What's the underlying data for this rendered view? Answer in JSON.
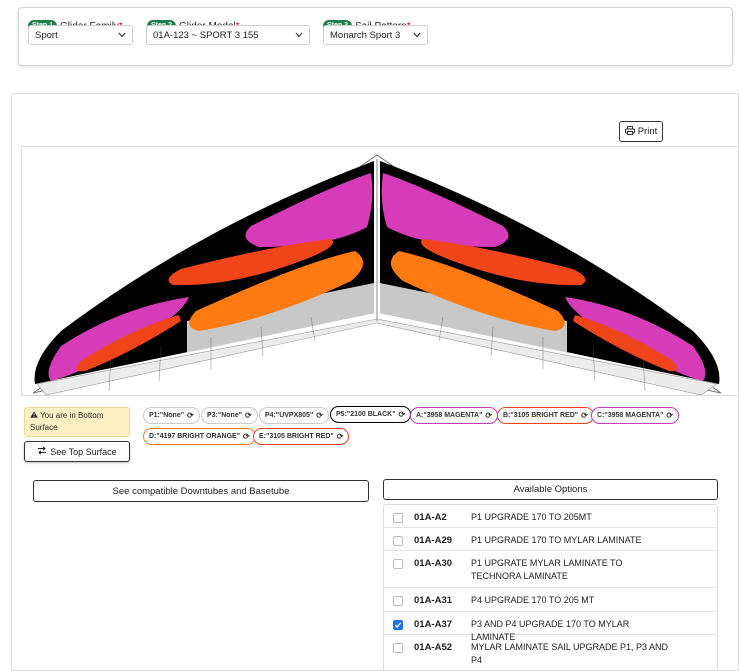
{
  "steps": [
    {
      "badge": "Step 1",
      "label": "Glider Family",
      "required": "*",
      "value": "Sport"
    },
    {
      "badge": "Step 2",
      "label": "Glider Model",
      "required": "*",
      "value": "01A-123 ~ SPORT 3 155"
    },
    {
      "badge": "Step 3",
      "label": "Sail Pattern",
      "required": "*",
      "value": "Monarch Sport 3"
    }
  ],
  "print_label": "Print",
  "surface_note": "You are in Bottom Surface",
  "see_top_label": "See Top Surface",
  "pills": [
    {
      "text": "P1:\"None\"",
      "color": "#cfcfcf"
    },
    {
      "text": "P3:\"None\"",
      "color": "#cfcfcf"
    },
    {
      "text": "P4:\"UVPX805\"",
      "color": "#cfcfcf"
    },
    {
      "text": "P5:\"2100 BLACK\"",
      "color": "#000000"
    },
    {
      "text": "A:\"3958 MAGENTA\"",
      "color": "#c53bbb"
    },
    {
      "text": "B:\"3105 BRIGHT RED\"",
      "color": "#e8451e"
    },
    {
      "text": "C:\"3958 MAGENTA\"",
      "color": "#c53bbb"
    },
    {
      "text": "D:\"4197 BRIGHT ORANGE\"",
      "color": "#f07a22"
    },
    {
      "text": "E:\"3105 BRIGHT RED\"",
      "color": "#e8451e"
    }
  ],
  "compat_label": "See compatible Downtubes and Basetube",
  "available_label": "Available Options",
  "options": [
    {
      "code": "01A-A2",
      "desc": "P1 UPGRADE 170 TO 205MT",
      "checked": false
    },
    {
      "code": "01A-A29",
      "desc": "P1 UPGRADE 170 TO MYLAR LAMINATE",
      "checked": false
    },
    {
      "code": "01A-A30",
      "desc": "P1 UPGRATE MYLAR LAMINATE TO TECHNORA LAMINATE",
      "checked": false
    },
    {
      "code": "01A-A31",
      "desc": "P4 UPGRADE 170 TO 205 MT",
      "checked": false
    },
    {
      "code": "01A-A37",
      "desc": "P3 AND P4 UPGRADE 170 TO MYLAR LAMINATE",
      "checked": true
    },
    {
      "code": "01A-A52",
      "desc": "MYLAR LAMINATE SAIL UPGRADE P1, P3 AND P4",
      "checked": false
    }
  ],
  "colors": {
    "step_badge": "#1e7f4e",
    "required": "#d00000",
    "sail_black": "#000000",
    "magenta": "#d63bb8",
    "bright_red": "#f0441a",
    "bright_orange": "#ff7a10",
    "checkbox_checked": "#1a73e8",
    "note_bg": "#fcefc3"
  },
  "icons": {
    "chevron": "chevron-down-icon",
    "print": "printer-icon",
    "warning": "warning-icon",
    "swap": "swap-arrows-icon",
    "refresh": "refresh-icon",
    "check": "checkmark-icon"
  }
}
